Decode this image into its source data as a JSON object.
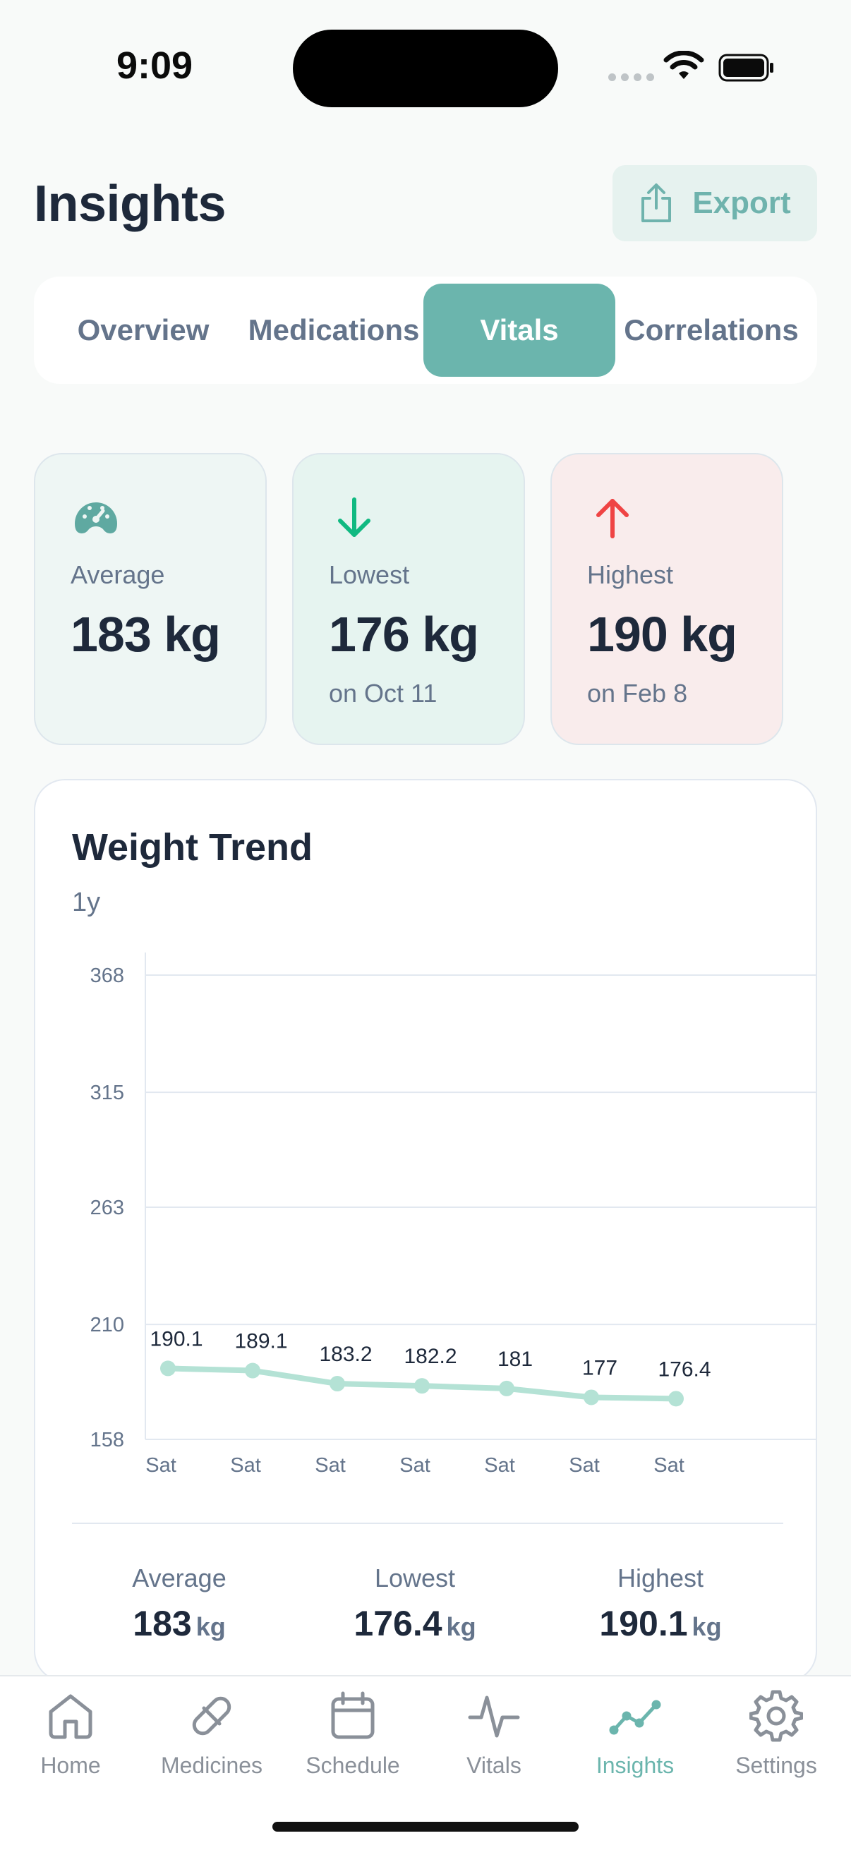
{
  "status_bar": {
    "time": "9:09"
  },
  "header": {
    "title": "Insights",
    "export_label": "Export"
  },
  "tabs": [
    {
      "label": "Overview",
      "active": false
    },
    {
      "label": "Medications",
      "active": false
    },
    {
      "label": "Vitals",
      "active": true
    },
    {
      "label": "Correlations",
      "active": false
    }
  ],
  "stats": {
    "average": {
      "label": "Average",
      "value": "183 kg",
      "icon": "gauge-icon"
    },
    "lowest": {
      "label": "Lowest",
      "value": "176 kg",
      "sub": "on Oct 11",
      "icon": "arrow-down-icon"
    },
    "highest": {
      "label": "Highest",
      "value": "190 kg",
      "sub": "on Feb 8",
      "icon": "arrow-up-icon"
    }
  },
  "chart_data": {
    "type": "line",
    "title": "Weight Trend",
    "subtitle": "1y",
    "categories": [
      "Sat",
      "Sat",
      "Sat",
      "Sat",
      "Sat",
      "Sat",
      "Sat"
    ],
    "series": [
      {
        "values": [
          190.1,
          189.1,
          183.2,
          182.2,
          181,
          177,
          176.4
        ]
      }
    ],
    "y_ticks": [
      158,
      210,
      263,
      315,
      368
    ],
    "ylim": [
      158,
      368
    ],
    "grid": true,
    "color": "#b4e2d5"
  },
  "summary": {
    "average": {
      "label": "Average",
      "value": "183",
      "unit": "kg"
    },
    "lowest": {
      "label": "Lowest",
      "value": "176.4",
      "unit": "kg"
    },
    "highest": {
      "label": "Highest",
      "value": "190.1",
      "unit": "kg"
    }
  },
  "nav": [
    {
      "label": "Home",
      "icon": "home-icon",
      "active": false
    },
    {
      "label": "Medicines",
      "icon": "pill-icon",
      "active": false
    },
    {
      "label": "Schedule",
      "icon": "calendar-icon",
      "active": false
    },
    {
      "label": "Vitals",
      "icon": "pulse-icon",
      "active": false
    },
    {
      "label": "Insights",
      "icon": "trend-icon",
      "active": true
    },
    {
      "label": "Settings",
      "icon": "gear-icon",
      "active": false
    }
  ],
  "colors": {
    "accent": "#6bb5ad",
    "text_primary": "#1e293b",
    "text_secondary": "#64748b",
    "low": "#10b981",
    "high": "#ef4444"
  }
}
